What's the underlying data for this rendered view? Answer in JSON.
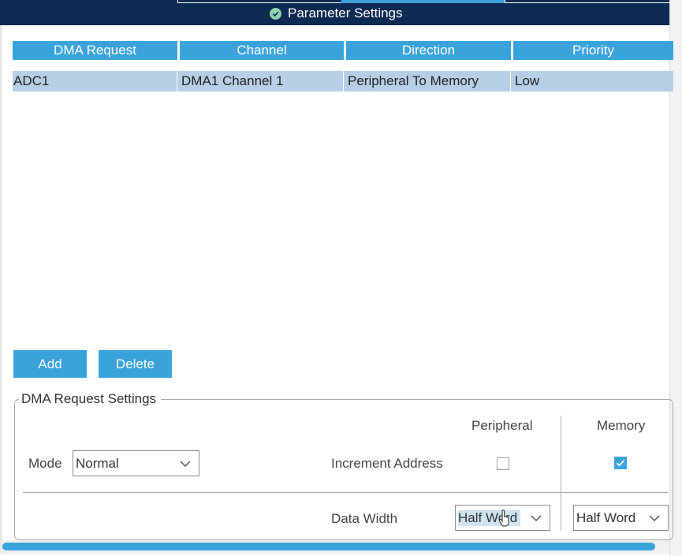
{
  "header": {
    "title": "Parameter Settings",
    "icon": "check-circle-icon"
  },
  "table": {
    "columns": [
      "DMA Request",
      "Channel",
      "Direction",
      "Priority"
    ],
    "rows": [
      [
        "ADC1",
        "DMA1 Channel 1",
        "Peripheral To Memory",
        "Low"
      ]
    ]
  },
  "buttons": {
    "add": "Add",
    "delete": "Delete"
  },
  "settings": {
    "legend": "DMA Request Settings",
    "mode_label": "Mode",
    "mode_value": "Normal",
    "peripheral_header": "Peripheral",
    "memory_header": "Memory",
    "increment_label": "Increment Address",
    "peripheral_increment": false,
    "memory_increment": true,
    "data_width_label": "Data Width",
    "peripheral_width": "Half Word",
    "memory_width": "Half Word"
  },
  "colors": {
    "header_bg": "#0d2a52",
    "accent": "#3aa3dc",
    "row_selected": "#b7cfe6"
  }
}
